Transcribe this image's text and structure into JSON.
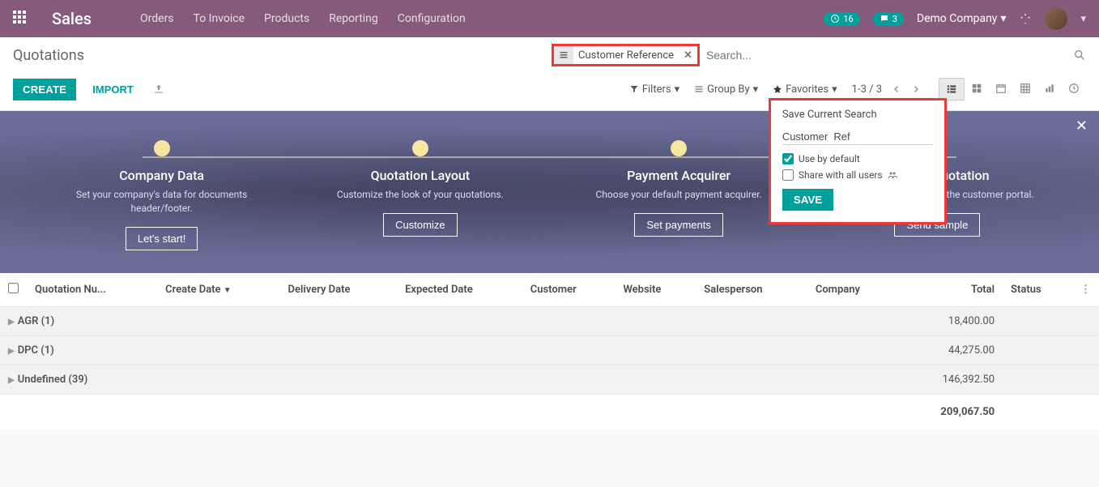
{
  "topnav": {
    "brand": "Sales",
    "links": [
      "Orders",
      "To Invoice",
      "Products",
      "Reporting",
      "Configuration"
    ],
    "activity_count": "16",
    "message_count": "3",
    "company": "Demo Company"
  },
  "cp": {
    "breadcrumb": "Quotations",
    "facet_label": "Customer Reference",
    "search_placeholder": "Search...",
    "create": "CREATE",
    "import": "IMPORT",
    "filters": "Filters",
    "groupby": "Group By",
    "favorites": "Favorites",
    "pager": "1-3 / 3"
  },
  "fav": {
    "title": "Save Current Search",
    "input_value": "Customer  Ref",
    "use_default": "Use by default",
    "share_all": "Share with all users",
    "save": "SAVE"
  },
  "onboard": {
    "steps": [
      {
        "title": "Company Data",
        "desc": "Set your company's data for documents header/footer.",
        "btn": "Let's start!"
      },
      {
        "title": "Quotation Layout",
        "desc": "Customize the look of your quotations.",
        "btn": "Customize"
      },
      {
        "title": "Payment Acquirer",
        "desc": "Choose your default payment acquirer.",
        "btn": "Set payments"
      },
      {
        "title": "Sample Quotation",
        "desc": "Send a quotation to test the customer portal.",
        "btn": "Send sample"
      }
    ]
  },
  "table": {
    "headers": [
      "Quotation Nu...",
      "Create Date",
      "Delivery Date",
      "Expected Date",
      "Customer",
      "Website",
      "Salesperson",
      "Company",
      "Total",
      "Status"
    ],
    "sort_col": "Create Date",
    "groups": [
      {
        "label": "AGR (1)",
        "total": "18,400.00"
      },
      {
        "label": "DPC (1)",
        "total": "44,275.00"
      },
      {
        "label": "Undefined (39)",
        "total": "146,392.50"
      }
    ],
    "grand_total": "209,067.50"
  }
}
